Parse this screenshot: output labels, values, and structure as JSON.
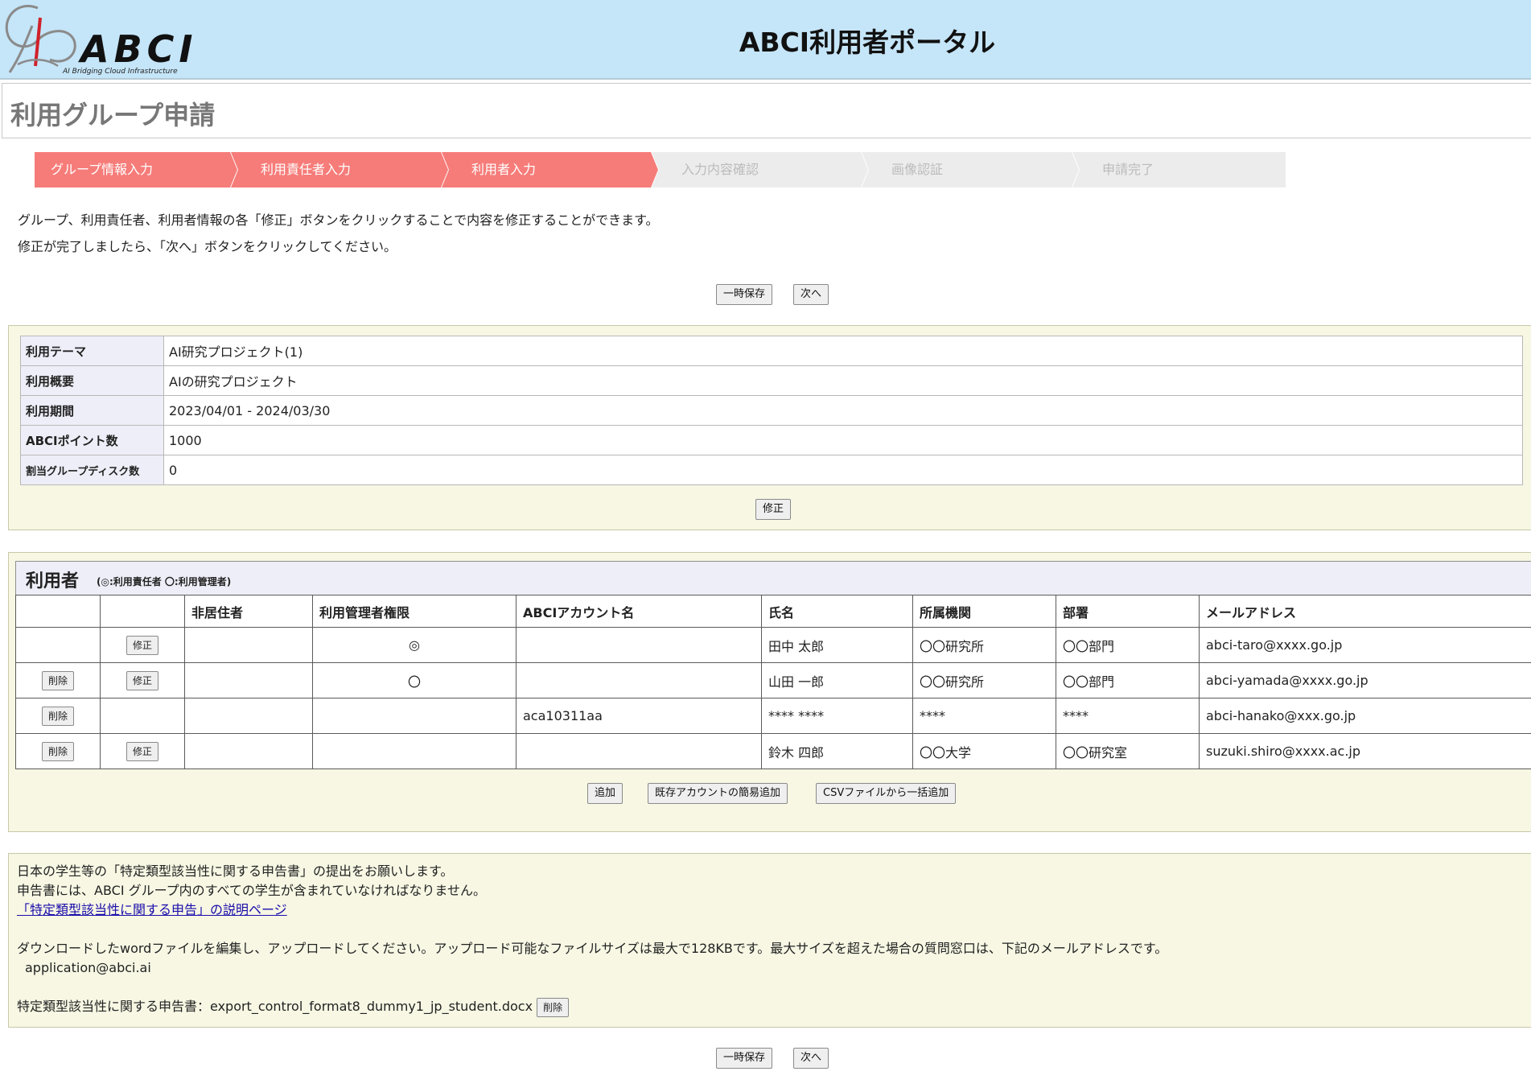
{
  "header": {
    "brand": "ABCI",
    "tagline": "AI Bridging Cloud Infrastructure",
    "site_title": "ABCI利用者ポータル"
  },
  "page": {
    "title": "利用グループ申請"
  },
  "steps": [
    {
      "label": "グループ情報入力",
      "state": "done"
    },
    {
      "label": "利用責任者入力",
      "state": "done"
    },
    {
      "label": "利用者入力",
      "state": "current"
    },
    {
      "label": "入力内容確認",
      "state": "todo"
    },
    {
      "label": "画像認証",
      "state": "todo"
    },
    {
      "label": "申請完了",
      "state": "todo"
    }
  ],
  "notes": {
    "line1": "グループ、利用責任者、利用者情報の各「修正」ボタンをクリックすることで内容を修正することができます。",
    "line2": "修正が完了しましたら、「次へ」ボタンをクリックしてください。"
  },
  "actions": {
    "save_label": "一時保存",
    "next_label": "次へ"
  },
  "group_info": {
    "rows": [
      {
        "label": "利用テーマ",
        "value": "AI研究プロジェクト(1)"
      },
      {
        "label": "利用概要",
        "value": "AIの研究プロジェクト"
      },
      {
        "label": "利用期間",
        "value": "2023/04/01 - 2024/03/30"
      },
      {
        "label": "ABCIポイント数",
        "value": "1000"
      },
      {
        "label": "割当グループディスク数",
        "value": "0"
      }
    ],
    "edit_label": "修正"
  },
  "users": {
    "title": "利用者",
    "legend": "(◎:利用責任者 〇:利用管理者)",
    "columns": [
      "",
      "",
      "非居住者",
      "利用管理者権限",
      "ABCIアカウント名",
      "氏名",
      "所属機関",
      "部署",
      "メールアドレス"
    ],
    "delete_label": "削除",
    "edit_label": "修正",
    "rows": [
      {
        "delete": "",
        "edit": "修正",
        "nonresident": "",
        "admin": "◎",
        "account": "",
        "name": "田中 太郎",
        "org": "〇〇研究所",
        "dept": "〇〇部門",
        "email": "abci-taro@xxxx.go.jp"
      },
      {
        "delete": "削除",
        "edit": "修正",
        "nonresident": "",
        "admin": "〇",
        "account": "",
        "name": "山田 一郎",
        "org": "〇〇研究所",
        "dept": "〇〇部門",
        "email": "abci-yamada@xxxx.go.jp"
      },
      {
        "delete": "削除",
        "edit": "",
        "nonresident": "",
        "admin": "",
        "account": "aca10311aa",
        "name": "**** ****",
        "org": "****",
        "dept": "****",
        "email": "abci-hanako@xxx.go.jp"
      },
      {
        "delete": "削除",
        "edit": "修正",
        "nonresident": "",
        "admin": "",
        "account": "",
        "name": "鈴木 四郎",
        "org": "〇〇大学",
        "dept": "〇〇研究室",
        "email": "suzuki.shiro@xxxx.ac.jp"
      }
    ],
    "add_label": "追加",
    "add_existing_label": "既存アカウントの簡易追加",
    "csv_label": "CSVファイルから一括追加"
  },
  "declaration": {
    "line1": "日本の学生等の「特定類型該当性に関する申告書」の提出をお願いします。",
    "line2": "申告書には、ABCI グループ内のすべての学生が含まれていなければなりません。",
    "link": "「特定類型該当性に関する申告」の説明ページ",
    "upload_note": "ダウンロードしたwordファイルを編集し、アップロードしてください。アップロード可能なファイルサイズは最大で128KBです。最大サイズを超えた場合の質問窓口は、下記のメールアドレスです。",
    "contact_email": "application@abci.ai",
    "file_label": "特定類型該当性に関する申告書：export_control_format8_dummy1_jp_student.docx",
    "delete_label": "削除"
  }
}
